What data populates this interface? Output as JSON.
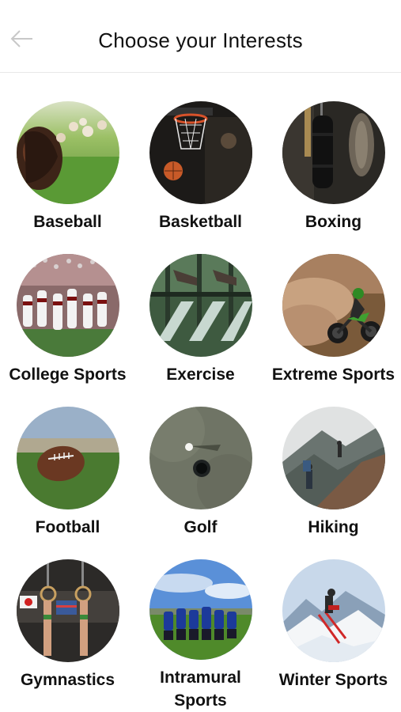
{
  "header": {
    "title": "Choose your Interests",
    "back_icon": "arrow-left-icon"
  },
  "colors": {
    "text": "#111111",
    "divider": "#e8e8e8",
    "icon": "#cccccc"
  },
  "interests": [
    {
      "label": "Baseball",
      "image": "baseball-glove-and-balls-photo"
    },
    {
      "label": "Basketball",
      "image": "basketball-hoop-photo"
    },
    {
      "label": "Boxing",
      "image": "punching-bag-photo"
    },
    {
      "label": "College Sports",
      "image": "football-team-photo"
    },
    {
      "label": "Exercise",
      "image": "gym-equipment-photo"
    },
    {
      "label": "Extreme Sports",
      "image": "dirt-bike-photo"
    },
    {
      "label": "Football",
      "image": "football-on-field-photo"
    },
    {
      "label": "Golf",
      "image": "golf-ball-and-hole-photo"
    },
    {
      "label": "Hiking",
      "image": "mountain-hikers-photo"
    },
    {
      "label": "Gymnastics",
      "image": "gymnastics-rings-photo"
    },
    {
      "label": "Intramural Sports",
      "image": "team-huddle-photo"
    },
    {
      "label": "Winter Sports",
      "image": "skier-on-snow-photo"
    }
  ]
}
